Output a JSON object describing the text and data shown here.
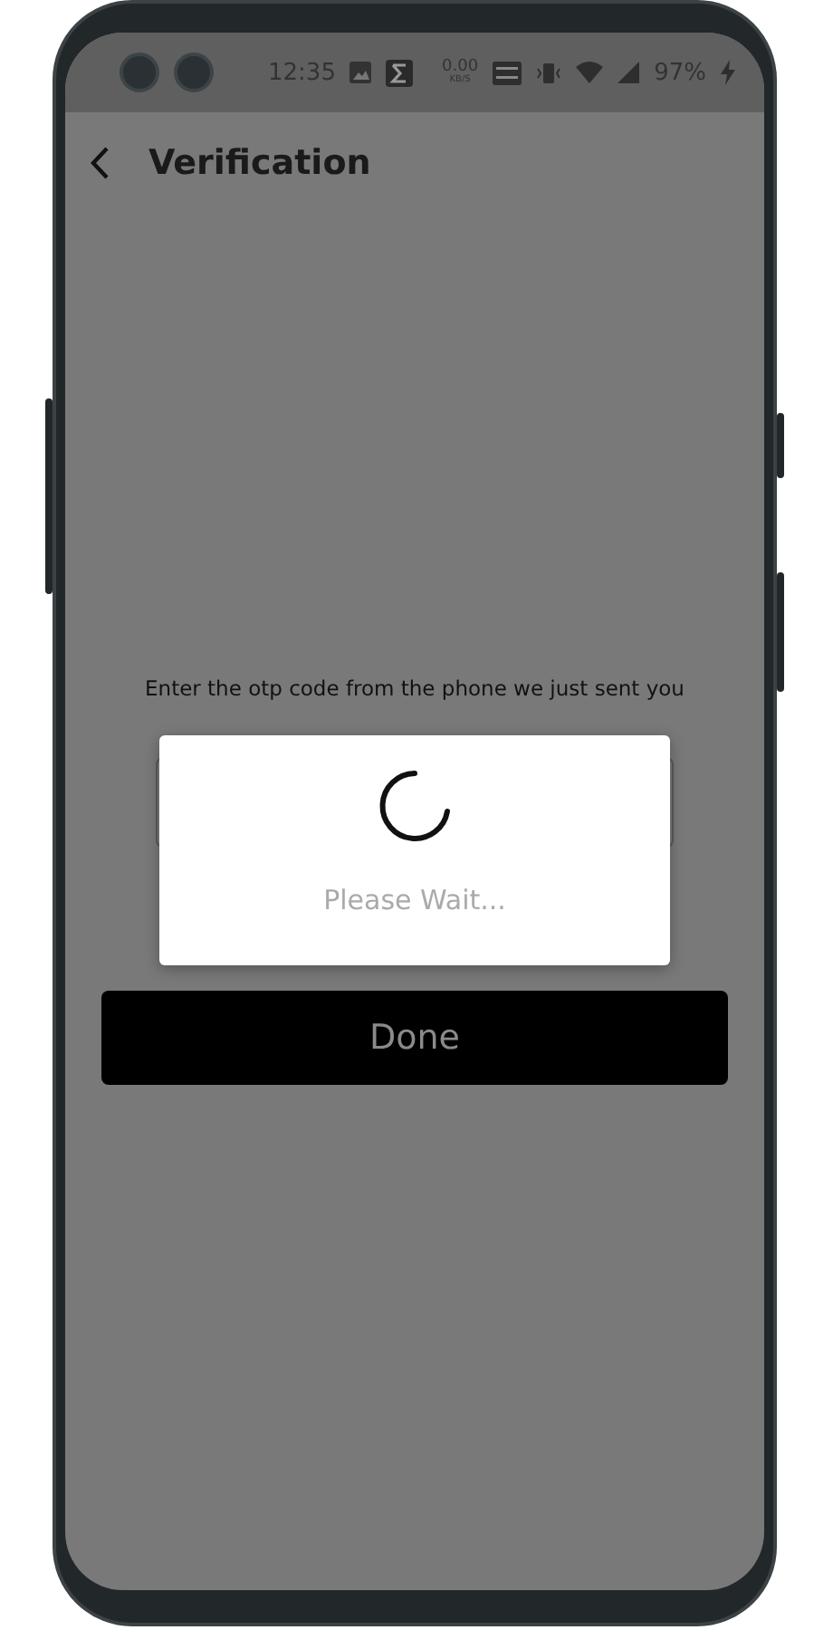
{
  "status_bar": {
    "time": "12:35",
    "net_speed": [
      "0.00",
      "KB/S"
    ],
    "battery": "97%"
  },
  "header": {
    "title": "Verification"
  },
  "prompt": "Enter the otp code from the phone we just sent you",
  "done_button": {
    "label": "Done"
  },
  "dialog": {
    "message": "Please Wait..."
  }
}
